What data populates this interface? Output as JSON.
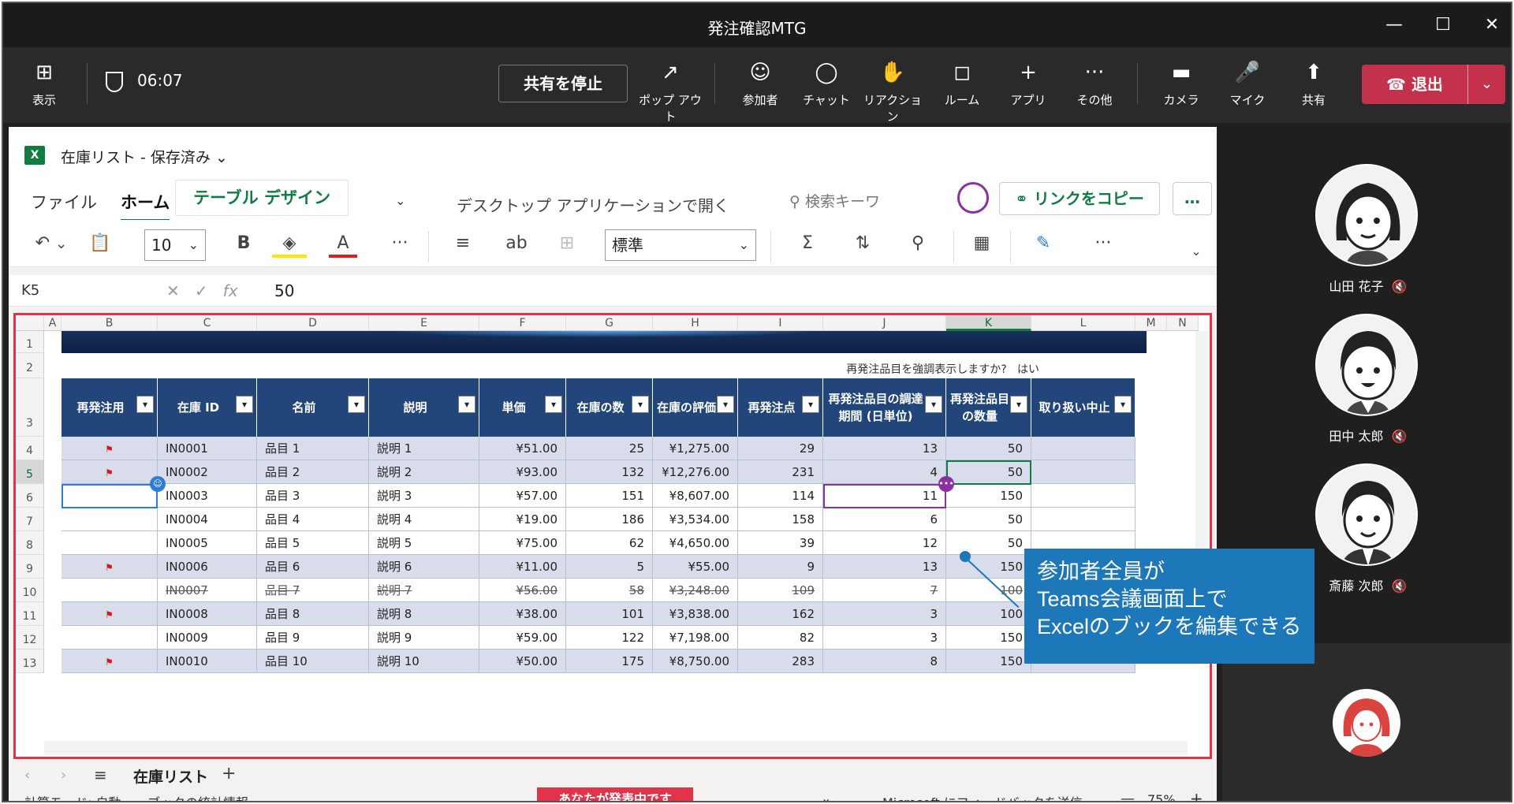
{
  "window": {
    "title": "発注確認MTG"
  },
  "teams": {
    "view_label": "表示",
    "timer": "06:07",
    "stop_share": "共有を停止",
    "popout": "ポップ アウト",
    "participants": "参加者",
    "chat": "チャット",
    "reactions": "リアクション",
    "rooms": "ルーム",
    "apps": "アプリ",
    "more": "その他",
    "camera": "カメラ",
    "mic": "マイク",
    "share": "共有",
    "leave": "退出"
  },
  "excel": {
    "workbook": "在庫リスト - 保存済み",
    "tabs": {
      "file": "ファイル",
      "home": "ホーム",
      "table_design": "テーブル デザイン"
    },
    "open_desktop": "デスクトップ アプリケーションで開く",
    "search_placeholder": "検索キーワ",
    "copy_link": "リンクをコピー",
    "more_options": "…",
    "font_size": "10",
    "number_format": "標準",
    "name_box": "K5",
    "formula_value": "50",
    "highlight_question": "再発注品目を強調表示しますか?",
    "highlight_answer": "はい",
    "sheet_name": "在庫リスト",
    "status_calc": "計算モード: 自動",
    "status_stats": "ブックの統計情報",
    "presenting": "あなたが発表中です",
    "feedback": "Microsoft にフィードバックを送信",
    "zoom": "75%"
  },
  "columns": [
    "A",
    "B",
    "C",
    "D",
    "E",
    "F",
    "G",
    "H",
    "I",
    "J",
    "K",
    "L",
    "M",
    "N"
  ],
  "table": {
    "headers": [
      "再発注用",
      "在庫 ID",
      "名前",
      "説明",
      "単価",
      "在庫の数",
      "在庫の評価",
      "再発注点",
      "再発注品目の調達期間 (日単位)",
      "再発注品目の数量",
      "取り扱い中止"
    ],
    "rows": [
      {
        "flag": true,
        "id": "IN0001",
        "name": "品目 1",
        "desc": "説明 1",
        "price": "¥51.00",
        "qty": "25",
        "value": "¥1,275.00",
        "reorder": "29",
        "lead": "13",
        "reqty": "50",
        "disc": "",
        "strike": false
      },
      {
        "flag": true,
        "id": "IN0002",
        "name": "品目 2",
        "desc": "説明 2",
        "price": "¥93.00",
        "qty": "132",
        "value": "¥12,276.00",
        "reorder": "231",
        "lead": "4",
        "reqty": "50",
        "disc": "",
        "strike": false
      },
      {
        "flag": false,
        "id": "IN0003",
        "name": "品目 3",
        "desc": "説明 3",
        "price": "¥57.00",
        "qty": "151",
        "value": "¥8,607.00",
        "reorder": "114",
        "lead": "11",
        "reqty": "150",
        "disc": "",
        "strike": false
      },
      {
        "flag": false,
        "id": "IN0004",
        "name": "品目 4",
        "desc": "説明 4",
        "price": "¥19.00",
        "qty": "186",
        "value": "¥3,534.00",
        "reorder": "158",
        "lead": "6",
        "reqty": "50",
        "disc": "",
        "strike": false
      },
      {
        "flag": false,
        "id": "IN0005",
        "name": "品目 5",
        "desc": "説明 5",
        "price": "¥75.00",
        "qty": "62",
        "value": "¥4,650.00",
        "reorder": "39",
        "lead": "12",
        "reqty": "50",
        "disc": "",
        "strike": false
      },
      {
        "flag": true,
        "id": "IN0006",
        "name": "品目 6",
        "desc": "説明 6",
        "price": "¥11.00",
        "qty": "5",
        "value": "¥55.00",
        "reorder": "9",
        "lead": "13",
        "reqty": "150",
        "disc": "",
        "strike": false
      },
      {
        "flag": false,
        "id": "IN0007",
        "name": "品目 7",
        "desc": "説明 7",
        "price": "¥56.00",
        "qty": "58",
        "value": "¥3,248.00",
        "reorder": "109",
        "lead": "7",
        "reqty": "100",
        "disc": "",
        "strike": true
      },
      {
        "flag": true,
        "id": "IN0008",
        "name": "品目 8",
        "desc": "説明 8",
        "price": "¥38.00",
        "qty": "101",
        "value": "¥3,838.00",
        "reorder": "162",
        "lead": "3",
        "reqty": "100",
        "disc": "",
        "strike": false
      },
      {
        "flag": false,
        "id": "IN0009",
        "name": "品目 9",
        "desc": "説明 9",
        "price": "¥59.00",
        "qty": "122",
        "value": "¥7,198.00",
        "reorder": "82",
        "lead": "3",
        "reqty": "150",
        "disc": "",
        "strike": false
      },
      {
        "flag": true,
        "id": "IN0010",
        "name": "品目 10",
        "desc": "説明 10",
        "price": "¥50.00",
        "qty": "175",
        "value": "¥8,750.00",
        "reorder": "283",
        "lead": "8",
        "reqty": "150",
        "disc": "",
        "strike": false
      }
    ]
  },
  "callout": {
    "line1": "参加者全員が",
    "line2": "Teams会議画面上で",
    "line3": "Excelのブックを編集できる"
  },
  "participants": [
    {
      "name": "山田 花子"
    },
    {
      "name": "田中 太郎"
    },
    {
      "name": "斎藤 次郎"
    }
  ],
  "colors": {
    "accent_excel": "#107c41",
    "leave": "#c4314b",
    "presenting": "#e1344b",
    "callout": "#1d78b9",
    "table_header": "#23467a"
  }
}
